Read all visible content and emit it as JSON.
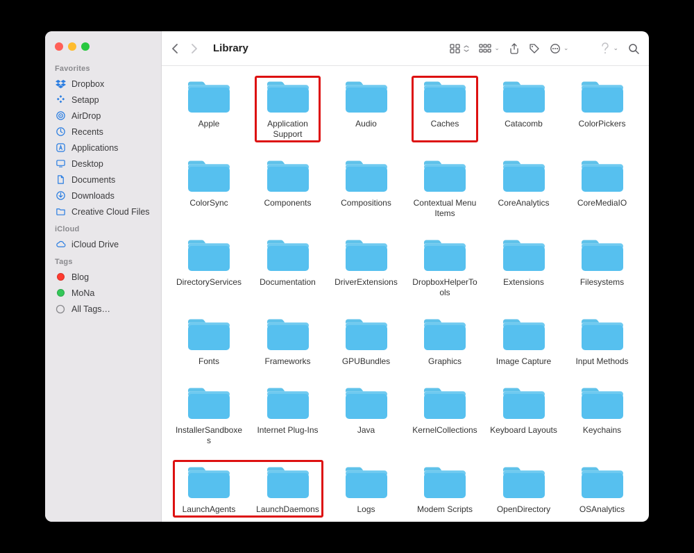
{
  "window_title": "Library",
  "sidebar": {
    "favorites_label": "Favorites",
    "favorites": [
      {
        "icon": "dropbox",
        "label": "Dropbox"
      },
      {
        "icon": "setapp",
        "label": "Setapp"
      },
      {
        "icon": "airdrop",
        "label": "AirDrop"
      },
      {
        "icon": "clock",
        "label": "Recents"
      },
      {
        "icon": "app",
        "label": "Applications"
      },
      {
        "icon": "desktop",
        "label": "Desktop"
      },
      {
        "icon": "doc",
        "label": "Documents"
      },
      {
        "icon": "down",
        "label": "Downloads"
      },
      {
        "icon": "folder",
        "label": "Creative Cloud Files"
      }
    ],
    "icloud_label": "iCloud",
    "icloud": [
      {
        "icon": "cloud",
        "label": "iCloud Drive"
      }
    ],
    "tags_label": "Tags",
    "tags": [
      {
        "color": "#ff3b30",
        "label": "Blog"
      },
      {
        "color": "#34c759",
        "label": "MoNa"
      },
      {
        "color": "",
        "label": "All Tags…",
        "alltags": true
      }
    ]
  },
  "folders": [
    {
      "name": "Apple"
    },
    {
      "name": "Application Support",
      "highlighted": true
    },
    {
      "name": "Audio"
    },
    {
      "name": "Caches",
      "highlighted": true
    },
    {
      "name": "Catacomb"
    },
    {
      "name": "ColorPickers"
    },
    {
      "name": "ColorSync"
    },
    {
      "name": "Components"
    },
    {
      "name": "Compositions"
    },
    {
      "name": "Contextual Menu Items"
    },
    {
      "name": "CoreAnalytics"
    },
    {
      "name": "CoreMediaIO"
    },
    {
      "name": "DirectoryServices"
    },
    {
      "name": "Documentation"
    },
    {
      "name": "DriverExtensions"
    },
    {
      "name": "DropboxHelperTools"
    },
    {
      "name": "Extensions"
    },
    {
      "name": "Filesystems"
    },
    {
      "name": "Fonts"
    },
    {
      "name": "Frameworks"
    },
    {
      "name": "GPUBundles"
    },
    {
      "name": "Graphics"
    },
    {
      "name": "Image Capture"
    },
    {
      "name": "Input Methods"
    },
    {
      "name": "InstallerSandboxes"
    },
    {
      "name": "Internet Plug-Ins"
    },
    {
      "name": "Java"
    },
    {
      "name": "KernelCollections"
    },
    {
      "name": "Keyboard Layouts"
    },
    {
      "name": "Keychains"
    },
    {
      "name": "LaunchAgents",
      "pairHighlighted": "left"
    },
    {
      "name": "LaunchDaemons",
      "pairHighlighted": "right"
    },
    {
      "name": "Logs"
    },
    {
      "name": "Modem Scripts"
    },
    {
      "name": "OpenDirectory"
    },
    {
      "name": "OSAnalytics"
    }
  ]
}
